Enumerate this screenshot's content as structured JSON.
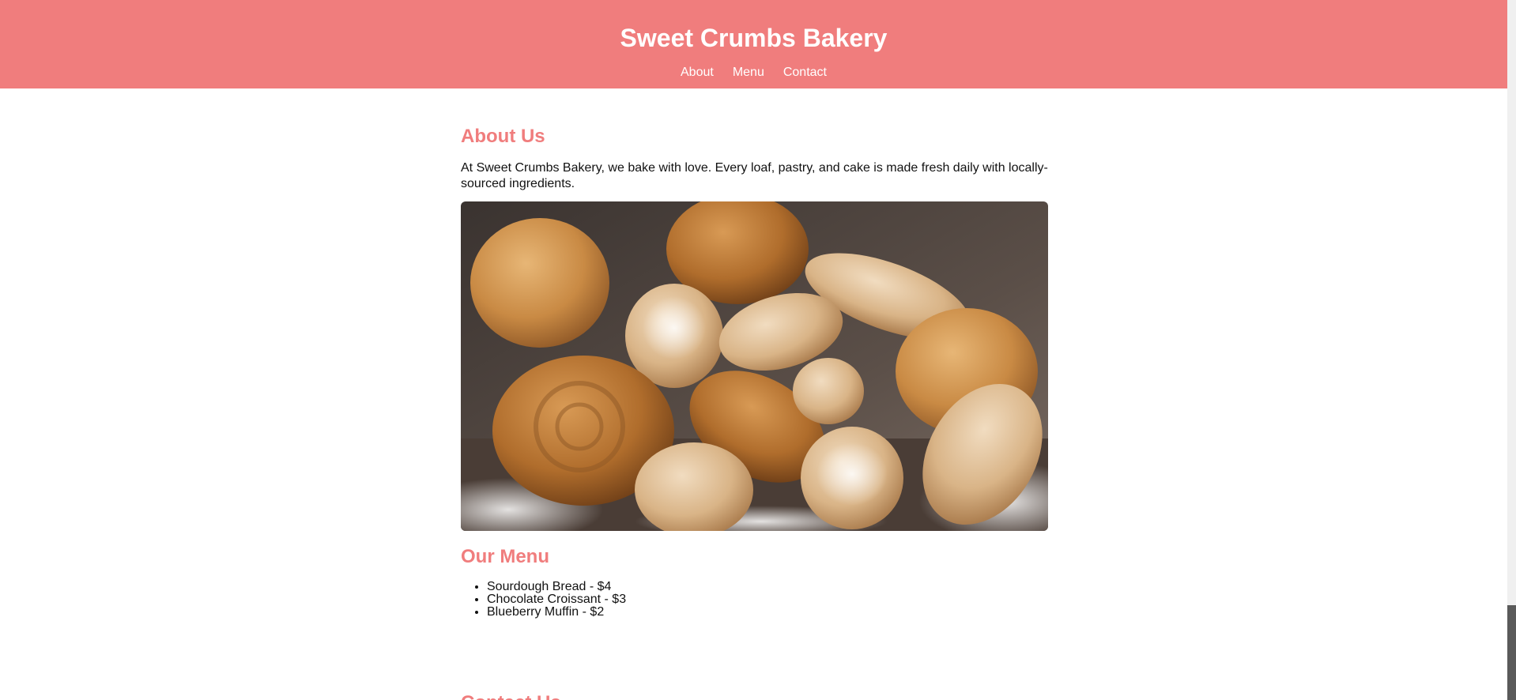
{
  "header": {
    "title": "Sweet Crumbs Bakery",
    "nav": [
      "About",
      "Menu",
      "Contact"
    ]
  },
  "about": {
    "heading": "About Us",
    "text": "At Sweet Crumbs Bakery, we bake with love. Every loaf, pastry, and cake is made fresh daily with locally-sourced ingredients.",
    "image_alt": "Assorted fresh breads"
  },
  "menu": {
    "heading": "Our Menu",
    "items": [
      "Sourdough Bread - $4",
      "Chocolate Croissant - $3",
      "Blueberry Muffin - $2"
    ]
  },
  "contact": {
    "heading": "Contact Us"
  },
  "colors": {
    "accent": "#f07d7d",
    "header_text": "#ffffff"
  }
}
